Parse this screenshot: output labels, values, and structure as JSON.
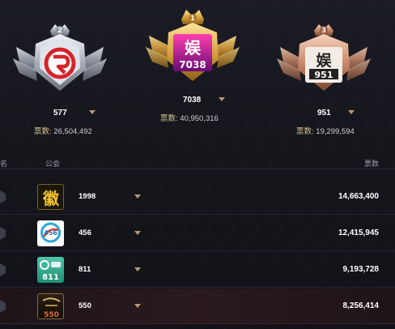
{
  "podium": [
    {
      "rank": "2",
      "name": "577",
      "votes_label": "票数:",
      "votes": "26,504,492",
      "logo_text": "",
      "logo_sub": ""
    },
    {
      "rank": "1",
      "name": "7038",
      "votes_label": "票数:",
      "votes": "40,950,316",
      "logo_text": "娱",
      "logo_sub": "7038"
    },
    {
      "rank": "3",
      "name": "951",
      "votes_label": "票数:",
      "votes": "19,299,594",
      "logo_text": "娱",
      "logo_sub": "951"
    }
  ],
  "table": {
    "headers": {
      "rank": "名",
      "guild": "公会",
      "votes": "票数"
    },
    "rows": [
      {
        "logo_text": "徽",
        "name": "1998",
        "votes": "14,663,400"
      },
      {
        "logo_text": "456",
        "name": "456",
        "votes": "12,415,945"
      },
      {
        "logo_text": "811",
        "name": "811",
        "votes": "9,193,728"
      },
      {
        "logo_text": "550",
        "name": "550",
        "votes": "8,256,414"
      }
    ]
  },
  "colors": {
    "gold": "#d9a441",
    "silver": "#b9bec8",
    "bronze": "#c98a6a",
    "accent_caret": "#b69a6a"
  }
}
